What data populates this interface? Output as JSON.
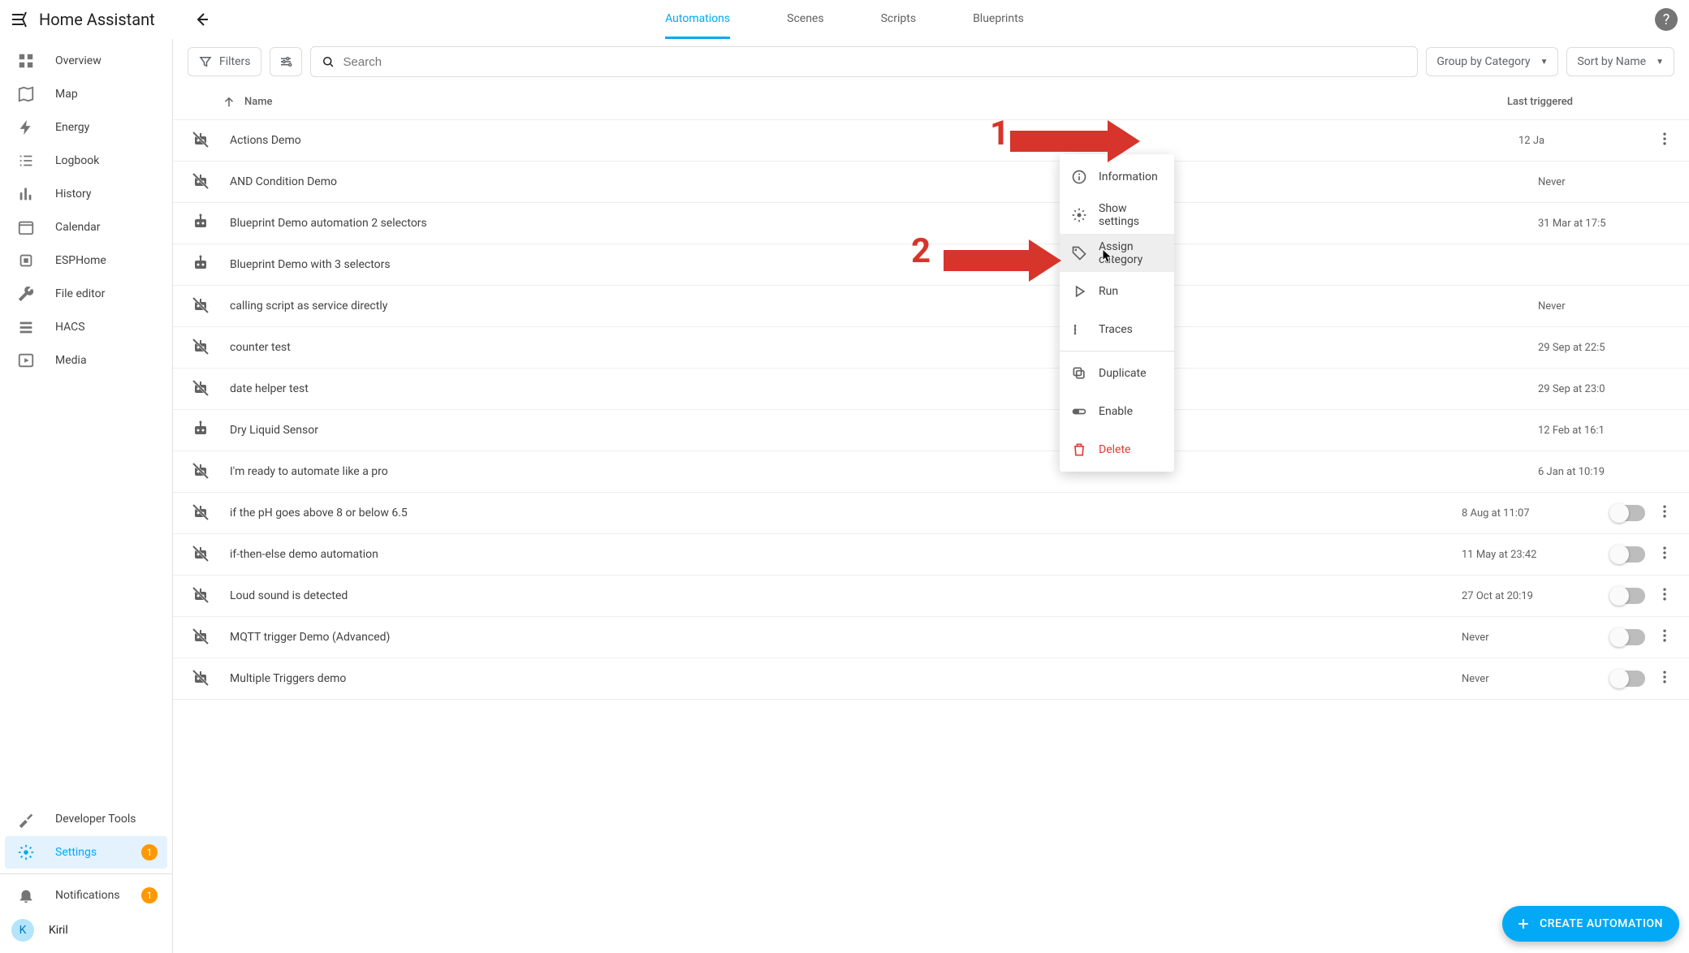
{
  "app": {
    "title": "Home Assistant"
  },
  "tabs": {
    "automations": "Automations",
    "scenes": "Scenes",
    "scripts": "Scripts",
    "blueprints": "Blueprints"
  },
  "sidebar": {
    "items": [
      {
        "icon": "dashboard",
        "label": "Overview"
      },
      {
        "icon": "map",
        "label": "Map"
      },
      {
        "icon": "bolt",
        "label": "Energy"
      },
      {
        "icon": "list",
        "label": "Logbook"
      },
      {
        "icon": "chart",
        "label": "History"
      },
      {
        "icon": "calendar",
        "label": "Calendar"
      },
      {
        "icon": "chip",
        "label": "ESPHome"
      },
      {
        "icon": "wrench",
        "label": "File editor"
      },
      {
        "icon": "hacs",
        "label": "HACS"
      },
      {
        "icon": "play",
        "label": "Media"
      }
    ],
    "dev": {
      "label": "Developer Tools"
    },
    "settings": {
      "label": "Settings",
      "badge": "1"
    },
    "notifications": {
      "label": "Notifications",
      "badge": "1"
    },
    "user": {
      "initial": "K",
      "name": "Kiril"
    }
  },
  "toolbar": {
    "filters": "Filters",
    "search_placeholder": "Search",
    "group": "Group by Category",
    "sort": "Sort by Name"
  },
  "columns": {
    "name": "Name",
    "last": "Last triggered"
  },
  "rows": [
    {
      "name": "Actions Demo",
      "trig": "12 Ja",
      "menu_open": true
    },
    {
      "name": "AND Condition Demo",
      "trig": "Never"
    },
    {
      "name": "Blueprint Demo automation 2 selectors",
      "trig": "31 Mar at 17:5",
      "blueprint": true
    },
    {
      "name": "Blueprint Demo with 3 selectors",
      "trig": "",
      "blueprint": true
    },
    {
      "name": "calling script as service directly",
      "trig": "Never"
    },
    {
      "name": "counter test",
      "trig": "29 Sep at 22:5"
    },
    {
      "name": "date helper test",
      "trig": "29 Sep at 23:0"
    },
    {
      "name": "Dry Liquid Sensor",
      "trig": "12 Feb at 16:1",
      "blueprint": true
    },
    {
      "name": "I'm ready to automate like a pro",
      "trig": "6 Jan at 10:19"
    },
    {
      "name": "if the pH goes above 8 or below 6.5",
      "trig": "8 Aug at 11:07",
      "toggle": true
    },
    {
      "name": "if-then-else demo automation",
      "trig": "11 May at 23:42",
      "toggle": true
    },
    {
      "name": "Loud sound is detected",
      "trig": "27 Oct at 20:19",
      "toggle": true
    },
    {
      "name": "MQTT trigger Demo (Advanced)",
      "trig": "Never",
      "toggle": true
    },
    {
      "name": "Multiple Triggers demo",
      "trig": "Never",
      "toggle": true
    }
  ],
  "ctx": {
    "information": "Information",
    "show_settings": "Show settings",
    "assign_category": "Assign category",
    "run": "Run",
    "traces": "Traces",
    "duplicate": "Duplicate",
    "enable": "Enable",
    "delete": "Delete"
  },
  "fab": {
    "label": "CREATE AUTOMATION"
  },
  "anno": {
    "n1": "1",
    "n2": "2"
  }
}
